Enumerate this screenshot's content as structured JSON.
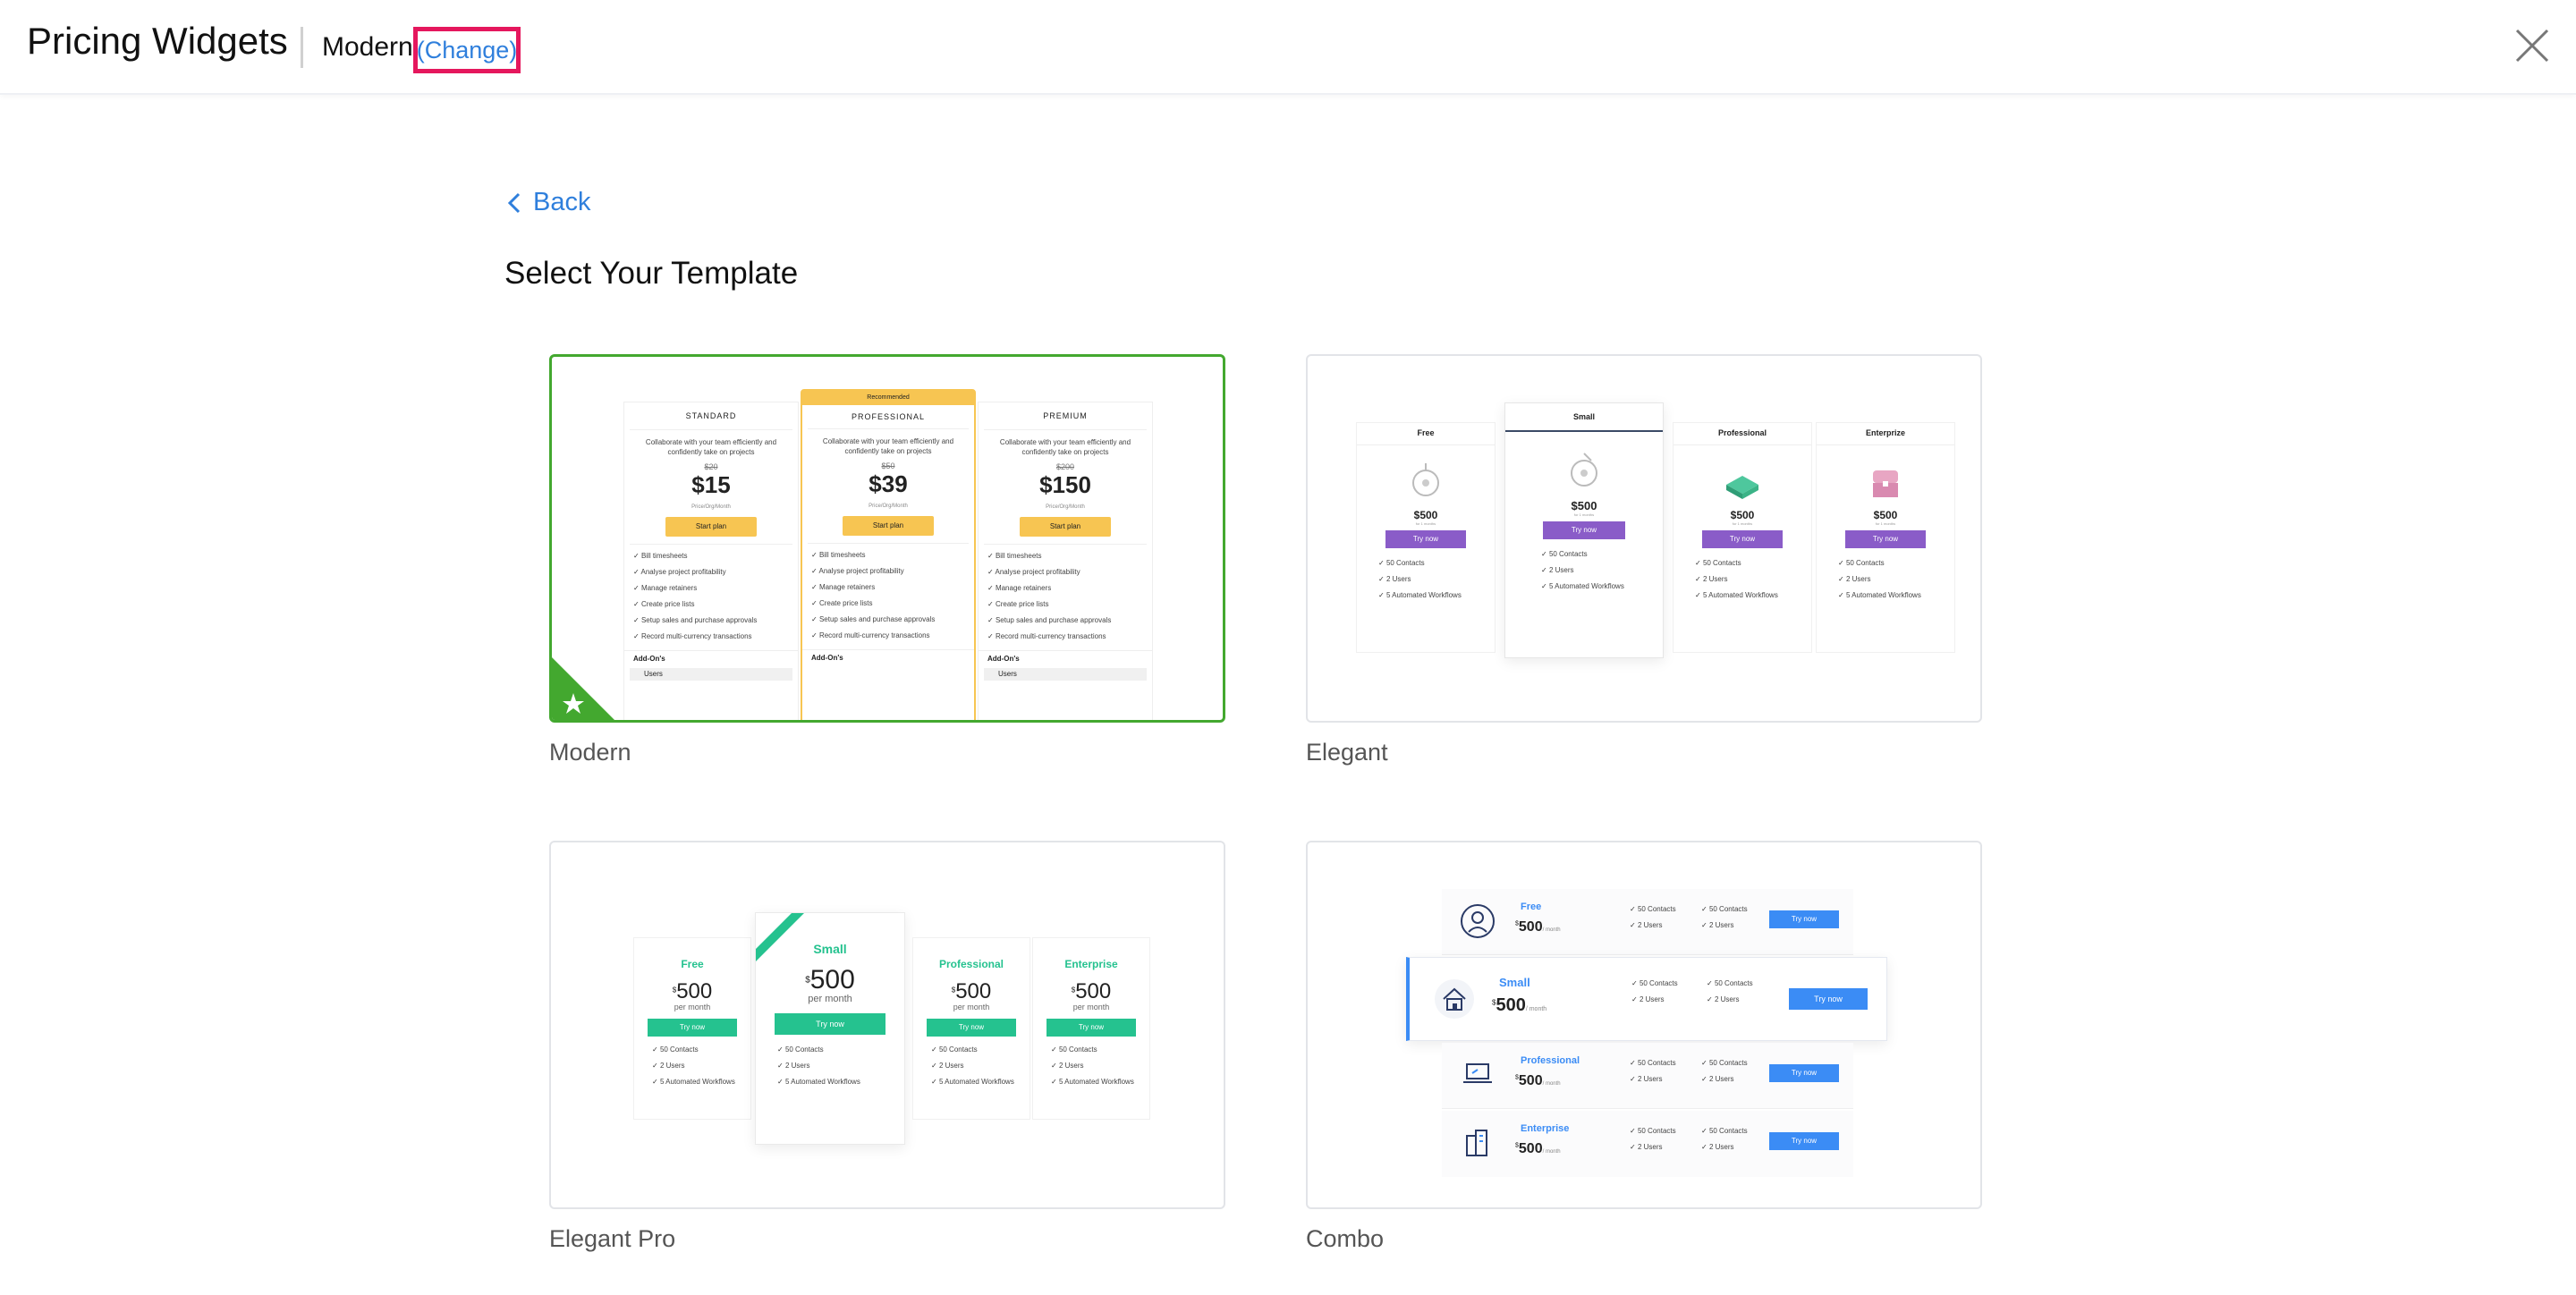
{
  "header": {
    "title": "Pricing Widgets",
    "current_template": "Modern",
    "change_label": "(Change)"
  },
  "back_label": "Back",
  "heading": "Select Your Template",
  "templates": [
    {
      "name": "Modern",
      "selected": true,
      "preview": {
        "plans": [
          {
            "name": "STANDARD",
            "desc": "Collaborate with your team efficiently and confidently take on projects",
            "old_price": "$20",
            "price": "$15",
            "period": "Price/Org/Month",
            "cta": "Start plan"
          },
          {
            "name": "PROFESSIONAL",
            "badge": "Recommended",
            "desc": "Collaborate with your team efficiently and confidently take on projects",
            "old_price": "$50",
            "price": "$39",
            "period": "Price/Org/Month",
            "cta": "Start plan"
          },
          {
            "name": "PREMIUM",
            "desc": "Collaborate with your team efficiently and confidently take on projects",
            "old_price": "$200",
            "price": "$150",
            "period": "Price/Org/Month",
            "cta": "Start plan"
          }
        ],
        "features": [
          "Bill timesheets",
          "Analyse project profitability",
          "Manage retainers",
          "Create price lists",
          "Setup sales and purchase approvals",
          "Record multi-currency transactions"
        ],
        "addons_label": "Add-On's",
        "addon_item": "Users"
      }
    },
    {
      "name": "Elegant",
      "preview": {
        "plans": [
          {
            "name": "Free",
            "price": "$500",
            "period": "for 1 months",
            "cta": "Try now"
          },
          {
            "name": "Small",
            "price": "$500",
            "period": "for 1 months",
            "cta": "Try now"
          },
          {
            "name": "Professional",
            "price": "$500",
            "period": "for 1 months",
            "cta": "Try now"
          },
          {
            "name": "Enterprize",
            "price": "$500",
            "period": "for 1 months",
            "cta": "Try now"
          }
        ],
        "features": [
          "50 Contacts",
          "2 Users",
          "5 Automated Workflows"
        ]
      }
    },
    {
      "name": "Elegant Pro",
      "preview": {
        "plans": [
          {
            "name": "Free",
            "price": "500",
            "period": "per month",
            "cta": "Try now"
          },
          {
            "name": "Small",
            "price": "500",
            "period": "per month",
            "cta": "Try now"
          },
          {
            "name": "Professional",
            "price": "500",
            "period": "per month",
            "cta": "Try now"
          },
          {
            "name": "Enterprise",
            "price": "500",
            "period": "per month",
            "cta": "Try now"
          }
        ],
        "features": [
          "50 Contacts",
          "2 Users",
          "5 Automated Workflows"
        ],
        "currency": "$"
      }
    },
    {
      "name": "Combo",
      "preview": {
        "plans": [
          {
            "name": "Free",
            "price": "500",
            "period": "/ month",
            "cta": "Try now"
          },
          {
            "name": "Small",
            "price": "500",
            "period": "/ month",
            "cta": "Try now"
          },
          {
            "name": "Professional",
            "price": "500",
            "period": "/ month",
            "cta": "Try now"
          },
          {
            "name": "Enterprise",
            "price": "500",
            "period": "/ month",
            "cta": "Try now"
          }
        ],
        "features": [
          "50 Contacts",
          "2 Users"
        ],
        "currency": "$"
      }
    }
  ],
  "colors": {
    "accent_blue": "#2f7fdc",
    "highlight_red": "#e5175d",
    "selected_green": "#43a82f",
    "modern_yellow": "#f7c552",
    "elegant_purple": "#8a5cc8",
    "elegant_pro_green": "#25c28f",
    "combo_blue": "#3b8cf5"
  }
}
